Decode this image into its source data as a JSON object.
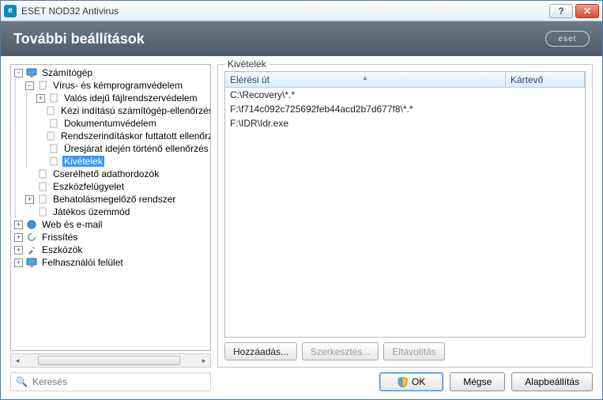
{
  "window": {
    "title": "ESET NOD32 Antivirus",
    "brand": "eset"
  },
  "header": {
    "title": "További beállítások"
  },
  "tree": {
    "computer": "Számítógép",
    "virus_protection": "Vírus- és kémprogramvédelem",
    "realtime": "Valós idejű fájlrendszervédelem",
    "manual_scan": "Kézi indítású számítógép-ellenőrzés",
    "document_protection": "Dokumentumvédelem",
    "startup_scan": "Rendszerindításkor futtatott ellenőrzés",
    "idle_scan": "Üresjárat idején történő ellenőrzés",
    "exclusions": "Kivételek",
    "removable_media": "Cserélhető adathordozók",
    "device_control": "Eszközfelügyelet",
    "hips": "Behatolásmegelőző rendszer",
    "gamer_mode": "Játékos üzemmód",
    "web_email": "Web és e-mail",
    "update": "Frissítés",
    "tools": "Eszközök",
    "ui": "Felhasználói felület"
  },
  "panel": {
    "legend": "Kivételek",
    "columns": {
      "path": "Elérési út",
      "threat": "Kártevő"
    },
    "rows": [
      "C:\\Recovery\\*.*",
      "F:\\f714c092c725692feb44acd2b7d677f8\\*.*",
      "F:\\IDR\\Idr.exe"
    ],
    "buttons": {
      "add": "Hozzáadás...",
      "edit": "Szerkesztés...",
      "remove": "Eltávolítás"
    }
  },
  "footer": {
    "search_placeholder": "Keresés",
    "ok": "OK",
    "cancel": "Mégse",
    "default": "Alapbeállítás"
  }
}
